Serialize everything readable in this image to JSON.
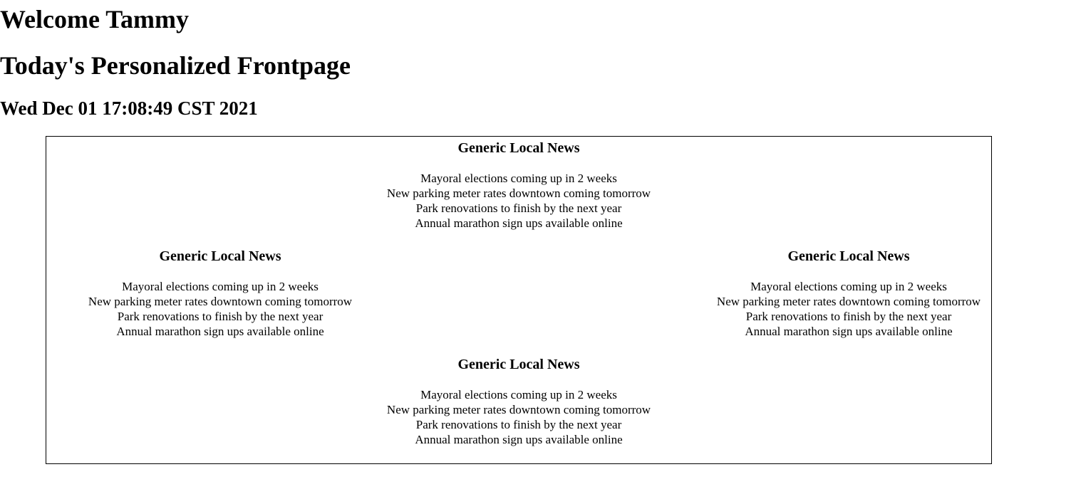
{
  "header": {
    "welcome": "Welcome Tammy",
    "frontpage": "Today's Personalized Frontpage",
    "date": "Wed Dec 01 17:08:49 CST 2021"
  },
  "panels": [
    {
      "title": "Generic Local News",
      "items": [
        "Mayoral elections coming up in 2 weeks",
        "New parking meter rates downtown coming tomorrow",
        "Park renovations to finish by the next year",
        "Annual marathon sign ups available online"
      ]
    },
    {
      "title": "Generic Local News",
      "items": [
        "Mayoral elections coming up in 2 weeks",
        "New parking meter rates downtown coming tomorrow",
        "Park renovations to finish by the next year",
        "Annual marathon sign ups available online"
      ]
    },
    {
      "title": "Generic Local News",
      "items": [
        "Mayoral elections coming up in 2 weeks",
        "New parking meter rates downtown coming tomorrow",
        "Park renovations to finish by the next year",
        "Annual marathon sign ups available online"
      ]
    },
    {
      "title": "Generic Local News",
      "items": [
        "Mayoral elections coming up in 2 weeks",
        "New parking meter rates downtown coming tomorrow",
        "Park renovations to finish by the next year",
        "Annual marathon sign ups available online"
      ]
    }
  ],
  "colors": {
    "text": "#000000",
    "background": "#ffffff",
    "border": "#000000"
  }
}
